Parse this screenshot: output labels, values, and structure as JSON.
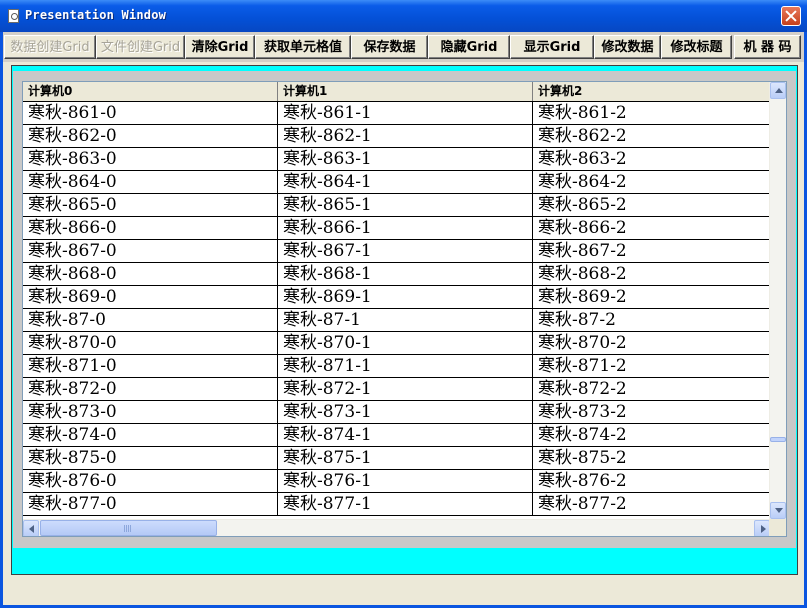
{
  "window": {
    "title": "Presentation Window"
  },
  "toolbar": {
    "buttons": [
      {
        "label": "数据创建Grid",
        "enabled": false
      },
      {
        "label": "文件创建Grid",
        "enabled": false
      },
      {
        "label": "清除Grid",
        "enabled": true
      },
      {
        "label": "获取单元格值",
        "enabled": true
      },
      {
        "label": "保存数据",
        "enabled": true
      },
      {
        "label": "隐藏Grid",
        "enabled": true
      },
      {
        "label": "显示Grid",
        "enabled": true
      },
      {
        "label": "修改数据",
        "enabled": true
      },
      {
        "label": "修改标题",
        "enabled": true
      },
      {
        "label": "机 器 码",
        "enabled": true
      }
    ]
  },
  "grid": {
    "columns": [
      "计算机0",
      "计算机1",
      "计算机2"
    ],
    "rows": [
      [
        "寒秋-861-0",
        "寒秋-861-1",
        "寒秋-861-2"
      ],
      [
        "寒秋-862-0",
        "寒秋-862-1",
        "寒秋-862-2"
      ],
      [
        "寒秋-863-0",
        "寒秋-863-1",
        "寒秋-863-2"
      ],
      [
        "寒秋-864-0",
        "寒秋-864-1",
        "寒秋-864-2"
      ],
      [
        "寒秋-865-0",
        "寒秋-865-1",
        "寒秋-865-2"
      ],
      [
        "寒秋-866-0",
        "寒秋-866-1",
        "寒秋-866-2"
      ],
      [
        "寒秋-867-0",
        "寒秋-867-1",
        "寒秋-867-2"
      ],
      [
        "寒秋-868-0",
        "寒秋-868-1",
        "寒秋-868-2"
      ],
      [
        "寒秋-869-0",
        "寒秋-869-1",
        "寒秋-869-2"
      ],
      [
        "寒秋-87-0",
        "寒秋-87-1",
        "寒秋-87-2"
      ],
      [
        "寒秋-870-0",
        "寒秋-870-1",
        "寒秋-870-2"
      ],
      [
        "寒秋-871-0",
        "寒秋-871-1",
        "寒秋-871-2"
      ],
      [
        "寒秋-872-0",
        "寒秋-872-1",
        "寒秋-872-2"
      ],
      [
        "寒秋-873-0",
        "寒秋-873-1",
        "寒秋-873-2"
      ],
      [
        "寒秋-874-0",
        "寒秋-874-1",
        "寒秋-874-2"
      ],
      [
        "寒秋-875-0",
        "寒秋-875-1",
        "寒秋-875-2"
      ],
      [
        "寒秋-876-0",
        "寒秋-876-1",
        "寒秋-876-2"
      ],
      [
        "寒秋-877-0",
        "寒秋-877-1",
        "寒秋-877-2"
      ]
    ]
  },
  "icons": {
    "app": "document-icon",
    "close": "close-icon",
    "scroll_up": "arrow-up-icon",
    "scroll_down": "arrow-down-icon",
    "scroll_left": "arrow-left-icon",
    "scroll_right": "arrow-right-icon"
  },
  "colors": {
    "titlebar": "#0a5ce8",
    "panel_background": "#00ffff",
    "grid_area": "#c8c8c8",
    "close_button": "#d5532e"
  }
}
